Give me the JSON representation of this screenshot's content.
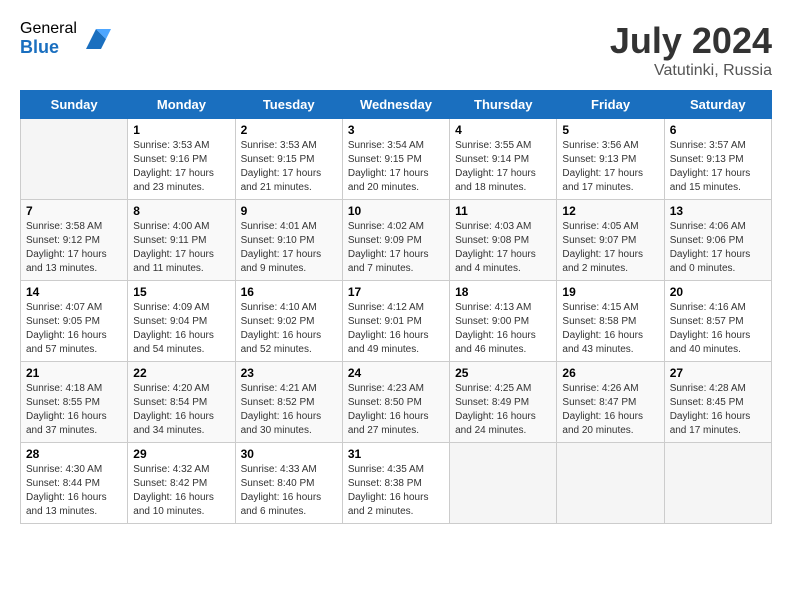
{
  "header": {
    "logo_general": "General",
    "logo_blue": "Blue",
    "month_year": "July 2024",
    "location": "Vatutinki, Russia"
  },
  "days_of_week": [
    "Sunday",
    "Monday",
    "Tuesday",
    "Wednesday",
    "Thursday",
    "Friday",
    "Saturday"
  ],
  "weeks": [
    [
      {
        "day": "",
        "sunrise": "",
        "sunset": "",
        "daylight": ""
      },
      {
        "day": "1",
        "sunrise": "Sunrise: 3:53 AM",
        "sunset": "Sunset: 9:16 PM",
        "daylight": "Daylight: 17 hours and 23 minutes."
      },
      {
        "day": "2",
        "sunrise": "Sunrise: 3:53 AM",
        "sunset": "Sunset: 9:15 PM",
        "daylight": "Daylight: 17 hours and 21 minutes."
      },
      {
        "day": "3",
        "sunrise": "Sunrise: 3:54 AM",
        "sunset": "Sunset: 9:15 PM",
        "daylight": "Daylight: 17 hours and 20 minutes."
      },
      {
        "day": "4",
        "sunrise": "Sunrise: 3:55 AM",
        "sunset": "Sunset: 9:14 PM",
        "daylight": "Daylight: 17 hours and 18 minutes."
      },
      {
        "day": "5",
        "sunrise": "Sunrise: 3:56 AM",
        "sunset": "Sunset: 9:13 PM",
        "daylight": "Daylight: 17 hours and 17 minutes."
      },
      {
        "day": "6",
        "sunrise": "Sunrise: 3:57 AM",
        "sunset": "Sunset: 9:13 PM",
        "daylight": "Daylight: 17 hours and 15 minutes."
      }
    ],
    [
      {
        "day": "7",
        "sunrise": "Sunrise: 3:58 AM",
        "sunset": "Sunset: 9:12 PM",
        "daylight": "Daylight: 17 hours and 13 minutes."
      },
      {
        "day": "8",
        "sunrise": "Sunrise: 4:00 AM",
        "sunset": "Sunset: 9:11 PM",
        "daylight": "Daylight: 17 hours and 11 minutes."
      },
      {
        "day": "9",
        "sunrise": "Sunrise: 4:01 AM",
        "sunset": "Sunset: 9:10 PM",
        "daylight": "Daylight: 17 hours and 9 minutes."
      },
      {
        "day": "10",
        "sunrise": "Sunrise: 4:02 AM",
        "sunset": "Sunset: 9:09 PM",
        "daylight": "Daylight: 17 hours and 7 minutes."
      },
      {
        "day": "11",
        "sunrise": "Sunrise: 4:03 AM",
        "sunset": "Sunset: 9:08 PM",
        "daylight": "Daylight: 17 hours and 4 minutes."
      },
      {
        "day": "12",
        "sunrise": "Sunrise: 4:05 AM",
        "sunset": "Sunset: 9:07 PM",
        "daylight": "Daylight: 17 hours and 2 minutes."
      },
      {
        "day": "13",
        "sunrise": "Sunrise: 4:06 AM",
        "sunset": "Sunset: 9:06 PM",
        "daylight": "Daylight: 17 hours and 0 minutes."
      }
    ],
    [
      {
        "day": "14",
        "sunrise": "Sunrise: 4:07 AM",
        "sunset": "Sunset: 9:05 PM",
        "daylight": "Daylight: 16 hours and 57 minutes."
      },
      {
        "day": "15",
        "sunrise": "Sunrise: 4:09 AM",
        "sunset": "Sunset: 9:04 PM",
        "daylight": "Daylight: 16 hours and 54 minutes."
      },
      {
        "day": "16",
        "sunrise": "Sunrise: 4:10 AM",
        "sunset": "Sunset: 9:02 PM",
        "daylight": "Daylight: 16 hours and 52 minutes."
      },
      {
        "day": "17",
        "sunrise": "Sunrise: 4:12 AM",
        "sunset": "Sunset: 9:01 PM",
        "daylight": "Daylight: 16 hours and 49 minutes."
      },
      {
        "day": "18",
        "sunrise": "Sunrise: 4:13 AM",
        "sunset": "Sunset: 9:00 PM",
        "daylight": "Daylight: 16 hours and 46 minutes."
      },
      {
        "day": "19",
        "sunrise": "Sunrise: 4:15 AM",
        "sunset": "Sunset: 8:58 PM",
        "daylight": "Daylight: 16 hours and 43 minutes."
      },
      {
        "day": "20",
        "sunrise": "Sunrise: 4:16 AM",
        "sunset": "Sunset: 8:57 PM",
        "daylight": "Daylight: 16 hours and 40 minutes."
      }
    ],
    [
      {
        "day": "21",
        "sunrise": "Sunrise: 4:18 AM",
        "sunset": "Sunset: 8:55 PM",
        "daylight": "Daylight: 16 hours and 37 minutes."
      },
      {
        "day": "22",
        "sunrise": "Sunrise: 4:20 AM",
        "sunset": "Sunset: 8:54 PM",
        "daylight": "Daylight: 16 hours and 34 minutes."
      },
      {
        "day": "23",
        "sunrise": "Sunrise: 4:21 AM",
        "sunset": "Sunset: 8:52 PM",
        "daylight": "Daylight: 16 hours and 30 minutes."
      },
      {
        "day": "24",
        "sunrise": "Sunrise: 4:23 AM",
        "sunset": "Sunset: 8:50 PM",
        "daylight": "Daylight: 16 hours and 27 minutes."
      },
      {
        "day": "25",
        "sunrise": "Sunrise: 4:25 AM",
        "sunset": "Sunset: 8:49 PM",
        "daylight": "Daylight: 16 hours and 24 minutes."
      },
      {
        "day": "26",
        "sunrise": "Sunrise: 4:26 AM",
        "sunset": "Sunset: 8:47 PM",
        "daylight": "Daylight: 16 hours and 20 minutes."
      },
      {
        "day": "27",
        "sunrise": "Sunrise: 4:28 AM",
        "sunset": "Sunset: 8:45 PM",
        "daylight": "Daylight: 16 hours and 17 minutes."
      }
    ],
    [
      {
        "day": "28",
        "sunrise": "Sunrise: 4:30 AM",
        "sunset": "Sunset: 8:44 PM",
        "daylight": "Daylight: 16 hours and 13 minutes."
      },
      {
        "day": "29",
        "sunrise": "Sunrise: 4:32 AM",
        "sunset": "Sunset: 8:42 PM",
        "daylight": "Daylight: 16 hours and 10 minutes."
      },
      {
        "day": "30",
        "sunrise": "Sunrise: 4:33 AM",
        "sunset": "Sunset: 8:40 PM",
        "daylight": "Daylight: 16 hours and 6 minutes."
      },
      {
        "day": "31",
        "sunrise": "Sunrise: 4:35 AM",
        "sunset": "Sunset: 8:38 PM",
        "daylight": "Daylight: 16 hours and 2 minutes."
      },
      {
        "day": "",
        "sunrise": "",
        "sunset": "",
        "daylight": ""
      },
      {
        "day": "",
        "sunrise": "",
        "sunset": "",
        "daylight": ""
      },
      {
        "day": "",
        "sunrise": "",
        "sunset": "",
        "daylight": ""
      }
    ]
  ]
}
